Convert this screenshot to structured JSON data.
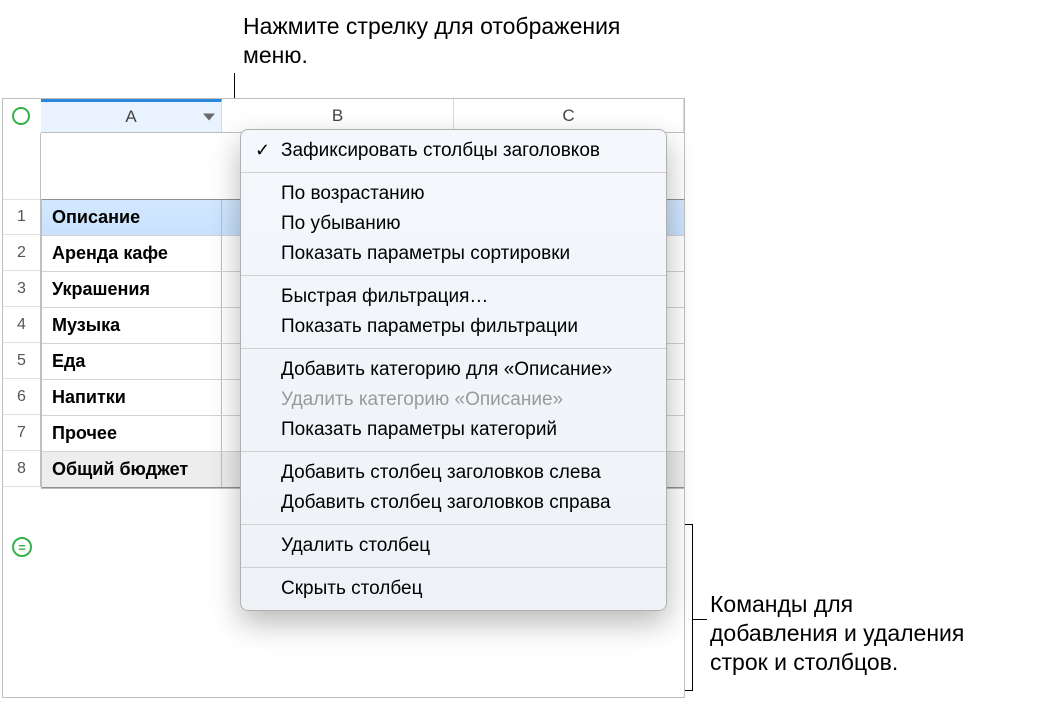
{
  "callouts": {
    "top": "Нажмите стрелку для отображения меню.",
    "right_line1": "Команды для",
    "right_line2": "добавления и удаления",
    "right_line3": "строк и столбцов."
  },
  "columns": {
    "a": "A",
    "b": "B",
    "c": "C"
  },
  "rows": [
    "1",
    "2",
    "3",
    "4",
    "5",
    "6",
    "7",
    "8"
  ],
  "table": {
    "header": "Описание",
    "data": [
      "Аренда кафе",
      "Украшения",
      "Музыка",
      "Еда",
      "Напитки",
      "Прочее"
    ],
    "footer": "Общий бюджет"
  },
  "add_row_glyph": "=",
  "menu": {
    "freeze": "Зафиксировать столбцы заголовков",
    "sort_asc": "По возрастанию",
    "sort_desc": "По убыванию",
    "sort_options": "Показать параметры сортировки",
    "quick_filter": "Быстрая фильтрация…",
    "filter_options": "Показать параметры фильтрации",
    "add_category": "Добавить категорию для «Описание»",
    "delete_category": "Удалить категорию «Описание»",
    "category_options": "Показать параметры категорий",
    "add_col_left": "Добавить столбец заголовков слева",
    "add_col_right": "Добавить столбец заголовков справа",
    "delete_col": "Удалить столбец",
    "hide_col": "Скрыть столбец"
  }
}
